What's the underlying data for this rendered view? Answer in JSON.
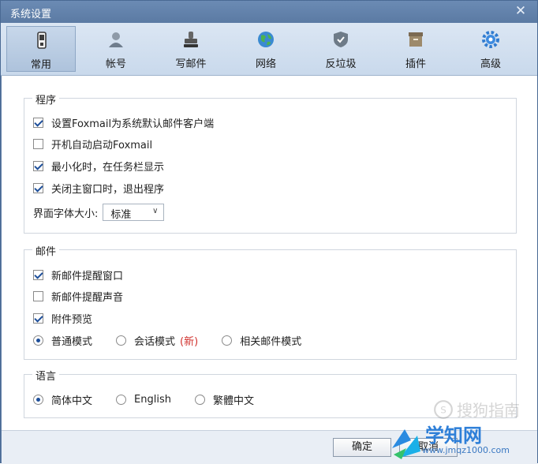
{
  "window": {
    "title": "系统设置"
  },
  "tabs": [
    {
      "label": "常用",
      "icon": "phone-icon"
    },
    {
      "label": "帐号",
      "icon": "user-icon"
    },
    {
      "label": "写邮件",
      "icon": "stamp-icon"
    },
    {
      "label": "网络",
      "icon": "globe-icon"
    },
    {
      "label": "反垃圾",
      "icon": "shield-icon"
    },
    {
      "label": "插件",
      "icon": "box-icon"
    },
    {
      "label": "高级",
      "icon": "gear-icon"
    }
  ],
  "program": {
    "title": "程序",
    "options": [
      {
        "label": "设置Foxmail为系统默认邮件客户端",
        "checked": true
      },
      {
        "label": "开机自动启动Foxmail",
        "checked": false
      },
      {
        "label": "最小化时，在任务栏显示",
        "checked": true
      },
      {
        "label": "关闭主窗口时，退出程序",
        "checked": true
      }
    ],
    "font_size_label": "界面字体大小:",
    "font_size_value": "标准"
  },
  "mail": {
    "title": "邮件",
    "options": [
      {
        "label": "新邮件提醒窗口",
        "checked": true
      },
      {
        "label": "新邮件提醒声音",
        "checked": false
      },
      {
        "label": "附件预览",
        "checked": true
      }
    ],
    "modes": [
      {
        "label": "普通模式",
        "checked": true
      },
      {
        "label": "会话模式",
        "checked": false
      },
      {
        "label": "相关邮件模式",
        "checked": false
      }
    ],
    "new_badge": "(新)"
  },
  "language": {
    "title": "语言",
    "options": [
      {
        "label": "简体中文",
        "checked": true
      },
      {
        "label": "English",
        "checked": false
      },
      {
        "label": "繁體中文",
        "checked": false
      }
    ]
  },
  "footer": {
    "ok_label": "确定",
    "cancel_label": "取消"
  },
  "watermark": {
    "text1": "搜狗指南",
    "text2": "学知网",
    "text3": "www.jmqz1000.com"
  },
  "colors": {
    "titlebar": "#5f7ea7",
    "toolbar": "#d3e0ef",
    "accent": "#1e4f9a",
    "badge": "#d0312d"
  }
}
